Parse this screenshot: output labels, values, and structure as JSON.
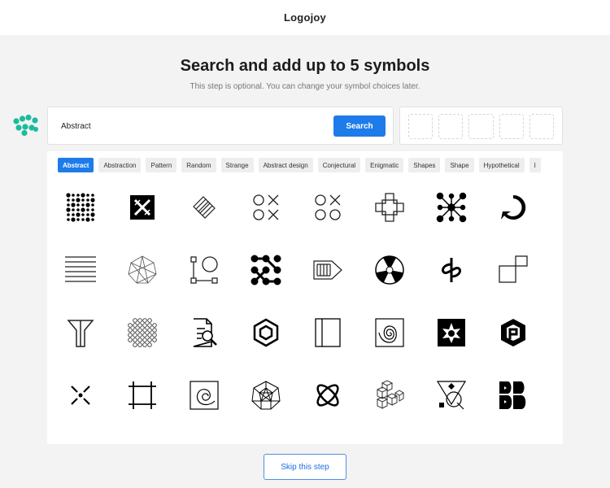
{
  "app": {
    "title": "Logojoy"
  },
  "page": {
    "heading": "Search and add up to 5 symbols",
    "subheading": "This step is optional. You can change your symbol choices later."
  },
  "search": {
    "value": "Abstract",
    "button_label": "Search"
  },
  "selected_slots": 5,
  "tags": [
    "Abstract",
    "Abstraction",
    "Pattern",
    "Random",
    "Strange",
    "Abstract design",
    "Conjectural",
    "Enigmatic",
    "Shapes",
    "Shape",
    "Hypothetical",
    "I"
  ],
  "active_tag": "Abstract",
  "symbols": [
    "dot-matrix-icon",
    "x-block-icon",
    "stacked-chevron-icon",
    "circle-cross-grid-icon",
    "circle-cross-grid-icon-2",
    "cross-outline-icon",
    "molecule-icon",
    "arrow-circle-icon",
    "horizontal-lines-icon",
    "geodesic-sphere-icon",
    "node-square-icon",
    "dot-network-icon",
    "arrow-frame-icon",
    "aperture-icon",
    "pretzel-icon",
    "square-offset-icon",
    "fork-icon",
    "dot-cluster-icon",
    "document-search-icon",
    "hexagon-icon",
    "book-frame-icon",
    "spiral-frame-icon",
    "star-square-icon",
    "hex-p-icon",
    "x-dot-icon",
    "square-handles-icon",
    "spiral-square-icon",
    "polyhedron-icon",
    "atom-icon",
    "cubes-icon",
    "geometric-compass-icon",
    "bold-b-icon"
  ],
  "footer": {
    "skip_label": "Skip this step"
  },
  "colors": {
    "accent": "#1e7bea",
    "logo_green": "#1abc9c"
  }
}
